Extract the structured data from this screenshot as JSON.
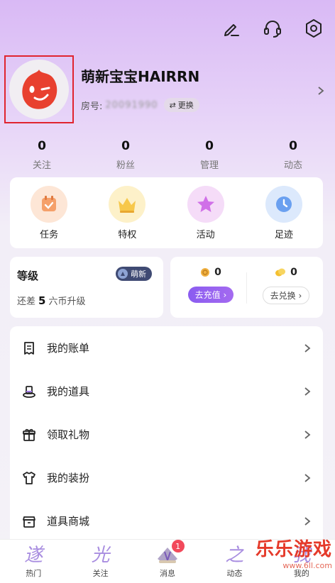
{
  "topbar": {
    "icons": [
      "edit-icon",
      "headset-icon",
      "settings-icon"
    ]
  },
  "profile": {
    "nickname": "萌新宝宝HAIRRN",
    "room_label": "房号:",
    "room_id": "20091990",
    "swap_label": "更换"
  },
  "stats": [
    {
      "count": "0",
      "label": "关注"
    },
    {
      "count": "0",
      "label": "粉丝"
    },
    {
      "count": "0",
      "label": "管理"
    },
    {
      "count": "0",
      "label": "动态"
    }
  ],
  "quick_actions": [
    {
      "label": "任务",
      "icon": "task-icon",
      "color": "#f5a06a"
    },
    {
      "label": "特权",
      "icon": "crown-icon",
      "color": "#f7c84a"
    },
    {
      "label": "活动",
      "icon": "star-icon",
      "color": "#d070e8"
    },
    {
      "label": "足迹",
      "icon": "clock-icon",
      "color": "#6aa0f0"
    }
  ],
  "level": {
    "title": "等级",
    "badge": "萌新",
    "prefix": "还差",
    "amount": "5",
    "suffix": "六币升级"
  },
  "wallet": {
    "coins": "0",
    "recharge_label": "去充值",
    "gems": "0",
    "exchange_label": "去兑换"
  },
  "menu": [
    {
      "label": "我的账单",
      "icon": "bill-icon"
    },
    {
      "label": "我的道具",
      "icon": "hat-icon"
    },
    {
      "label": "领取礼物",
      "icon": "gift-icon"
    },
    {
      "label": "我的装扮",
      "icon": "shirt-icon"
    },
    {
      "label": "道具商城",
      "icon": "shop-icon"
    }
  ],
  "tabbar": [
    {
      "label": "热门",
      "glyph": "遂"
    },
    {
      "label": "关注",
      "glyph": "光"
    },
    {
      "label": "消息",
      "glyph": "",
      "badge": "1"
    },
    {
      "label": "动态",
      "glyph": "之"
    },
    {
      "label": "我的",
      "glyph": "我"
    }
  ],
  "watermark": {
    "main": "乐乐游戏",
    "sub": "www.6ll.com"
  },
  "colors": {
    "accent": "#8a5cf0",
    "highlight_border": "#e0242f",
    "avatar_red": "#e8402f"
  }
}
